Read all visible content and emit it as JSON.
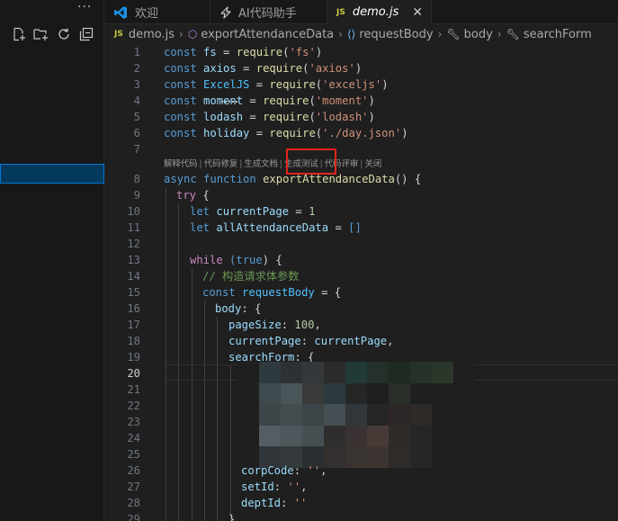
{
  "sidebar": {
    "more_icon": "ellipsis-icon",
    "actions": [
      "new-file-icon",
      "new-folder-icon",
      "refresh-icon",
      "collapse-all-icon"
    ]
  },
  "tabs": [
    {
      "label": "欢迎",
      "icon": "vscode-logo-icon"
    },
    {
      "label": "AI代码助手",
      "icon": "ai-assistant-icon"
    },
    {
      "label": "demo.js",
      "badge": "JS",
      "active": true,
      "close": "✕"
    }
  ],
  "breadcrumb": {
    "badge": "JS",
    "file": "demo.js",
    "items": [
      "exportAttendanceData",
      "requestBody",
      "body",
      "searchForm"
    ]
  },
  "editor": {
    "line_numbers": [
      "1",
      "2",
      "3",
      "4",
      "5",
      "6",
      "7",
      "8",
      "9",
      "10",
      "11",
      "12",
      "13",
      "14",
      "15",
      "16",
      "17",
      "18",
      "19",
      "20",
      "21",
      "22",
      "23",
      "24",
      "25",
      "26",
      "27",
      "28",
      "29"
    ],
    "active_line": "20",
    "code_lens": [
      "解释代码",
      "代码修复",
      "生成文档",
      "生成测试",
      "代码评审",
      "关闭"
    ],
    "code_lens_sep": "|",
    "code": {
      "l1": [
        "const",
        " ",
        "fs",
        " = ",
        "require",
        "(",
        "'fs'",
        ")"
      ],
      "l2": [
        "const",
        " ",
        "axios",
        " = ",
        "require",
        "(",
        "'axios'",
        ")"
      ],
      "l3": [
        "const",
        " ",
        "ExcelJS",
        " = ",
        "require",
        "(",
        "'exceljs'",
        ")"
      ],
      "l4": [
        "const",
        " ",
        "moment",
        " = ",
        "require",
        "(",
        "'moment'",
        ")"
      ],
      "l5": [
        "const",
        " ",
        "lodash",
        " = ",
        "require",
        "(",
        "'lodash'",
        ")"
      ],
      "l6": [
        "const",
        " ",
        "holiday",
        " = ",
        "require",
        "(",
        "'./day.json'",
        ")"
      ],
      "l8": [
        "async",
        " ",
        "function",
        " ",
        "exportAttendanceData",
        "() {"
      ],
      "l9": [
        "try",
        " {"
      ],
      "l10": [
        "let",
        " ",
        "currentPage",
        " = ",
        "1"
      ],
      "l11": [
        "let",
        " ",
        "allAttendanceData",
        " = ",
        "[]"
      ],
      "l13": [
        "while",
        " (",
        "true",
        ") {"
      ],
      "l14": "// 构造请求体参数",
      "l15": [
        "const",
        " ",
        "requestBody",
        " = {"
      ],
      "l16": [
        "body",
        ": {"
      ],
      "l17": [
        "pageSize",
        ": ",
        "100",
        ","
      ],
      "l18": [
        "currentPage",
        ": ",
        "currentPage",
        ","
      ],
      "l19": [
        "searchForm",
        ": {"
      ],
      "l26": [
        "corpCode",
        ": ",
        "''",
        ","
      ],
      "l27": [
        "setId",
        ": ",
        "''",
        ","
      ],
      "l28": [
        "deptId",
        ": ",
        "''"
      ],
      "l29": "}"
    }
  },
  "colors": {
    "keyword": "#569cd6",
    "variable": "#9cdcfe",
    "constant": "#4fc1ff",
    "function": "#dcdcaa",
    "string": "#ce9178",
    "number": "#b5cea8",
    "comment": "#6a9955",
    "highlight_box": "#e3241b"
  }
}
